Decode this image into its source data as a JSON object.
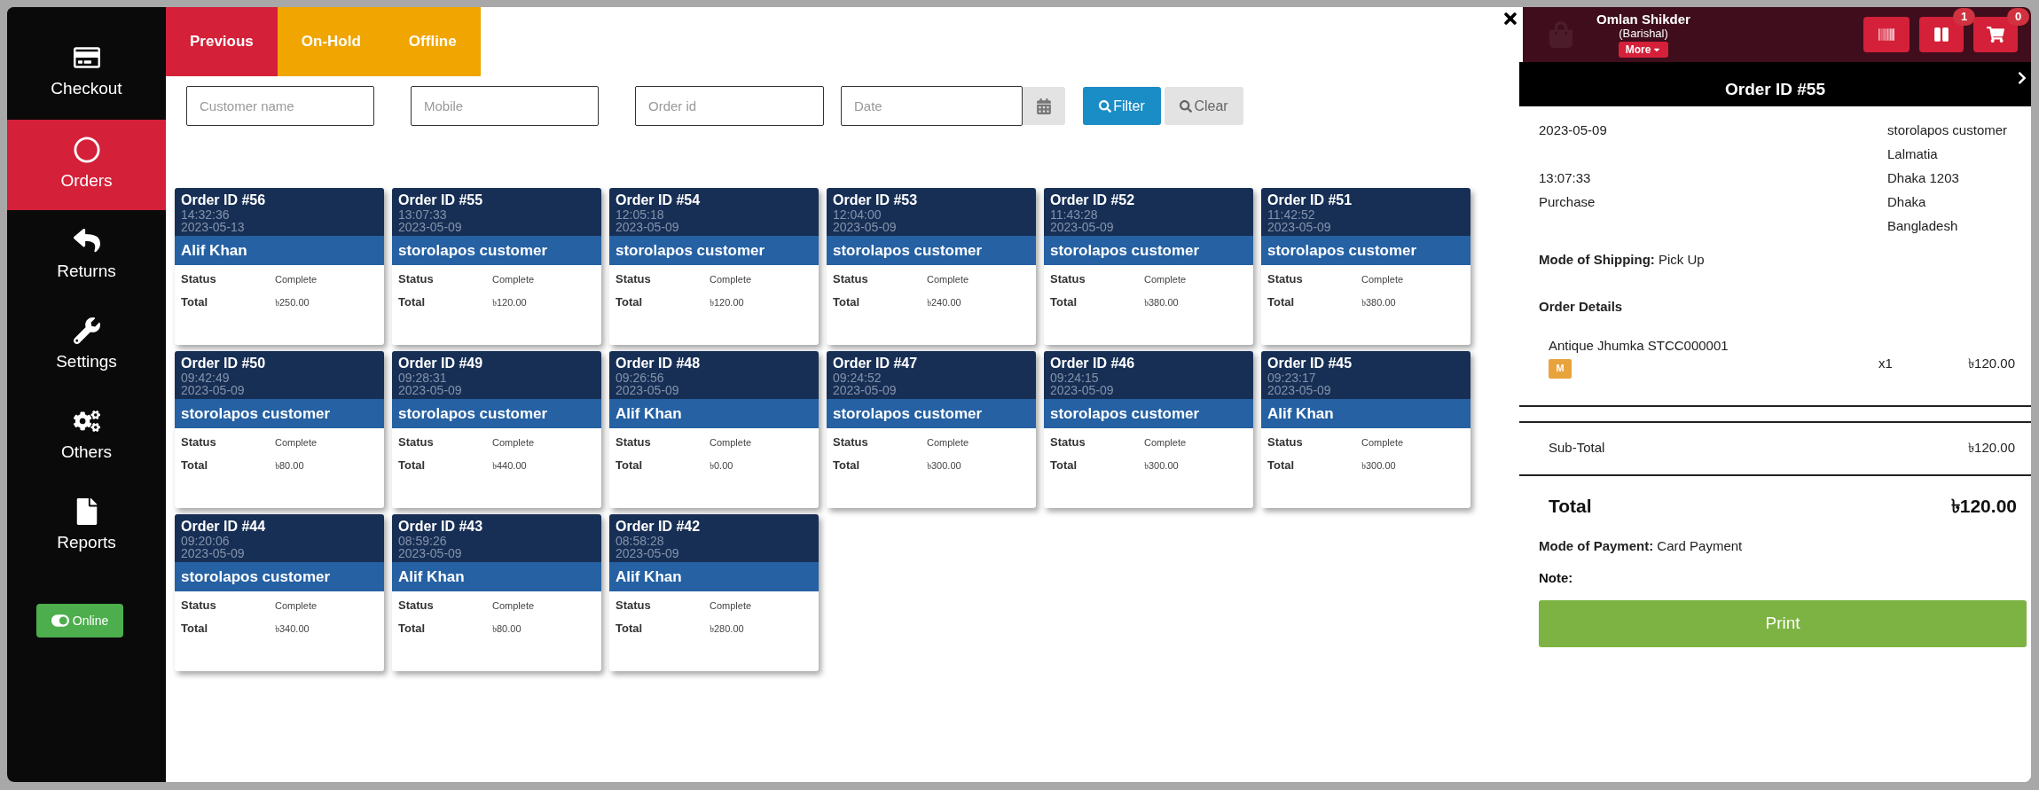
{
  "sidebar": {
    "items": [
      {
        "label": "Checkout",
        "selected": false
      },
      {
        "label": "Orders",
        "selected": true
      },
      {
        "label": "Returns",
        "selected": false
      },
      {
        "label": "Settings",
        "selected": false
      },
      {
        "label": "Others",
        "selected": false
      },
      {
        "label": "Reports",
        "selected": false
      }
    ],
    "connection_toggle": {
      "label": "Online",
      "on": true
    }
  },
  "tabs": [
    {
      "label": "Previous",
      "selected": true
    },
    {
      "label": "On-Hold",
      "selected": false
    },
    {
      "label": "Offline",
      "selected": false
    }
  ],
  "filters": {
    "customer_name": {
      "placeholder": "Customer name"
    },
    "mobile": {
      "placeholder": "Mobile"
    },
    "order_id": {
      "placeholder": "Order id"
    },
    "date": {
      "placeholder": "Date"
    },
    "filter_button": "Filter",
    "clear_button": "Clear"
  },
  "orders": [
    {
      "id": "Order ID #56",
      "time": "14:32:36",
      "date": "2023-05-13",
      "customer": "Alif Khan",
      "status_label": "Status",
      "status": "Complete",
      "total_label": "Total",
      "total": "৳250.00"
    },
    {
      "id": "Order ID #55",
      "time": "13:07:33",
      "date": "2023-05-09",
      "customer": "storolapos customer",
      "status_label": "Status",
      "status": "Complete",
      "total_label": "Total",
      "total": "৳120.00"
    },
    {
      "id": "Order ID #54",
      "time": "12:05:18",
      "date": "2023-05-09",
      "customer": "storolapos customer",
      "status_label": "Status",
      "status": "Complete",
      "total_label": "Total",
      "total": "৳120.00"
    },
    {
      "id": "Order ID #53",
      "time": "12:04:00",
      "date": "2023-05-09",
      "customer": "storolapos customer",
      "status_label": "Status",
      "status": "Complete",
      "total_label": "Total",
      "total": "৳240.00"
    },
    {
      "id": "Order ID #52",
      "time": "11:43:28",
      "date": "2023-05-09",
      "customer": "storolapos customer",
      "status_label": "Status",
      "status": "Complete",
      "total_label": "Total",
      "total": "৳380.00"
    },
    {
      "id": "Order ID #51",
      "time": "11:42:52",
      "date": "2023-05-09",
      "customer": "storolapos customer",
      "status_label": "Status",
      "status": "Complete",
      "total_label": "Total",
      "total": "৳380.00"
    },
    {
      "id": "Order ID #50",
      "time": "09:42:49",
      "date": "2023-05-09",
      "customer": "storolapos customer",
      "status_label": "Status",
      "status": "Complete",
      "total_label": "Total",
      "total": "৳80.00"
    },
    {
      "id": "Order ID #49",
      "time": "09:28:31",
      "date": "2023-05-09",
      "customer": "storolapos customer",
      "status_label": "Status",
      "status": "Complete",
      "total_label": "Total",
      "total": "৳440.00"
    },
    {
      "id": "Order ID #48",
      "time": "09:26:56",
      "date": "2023-05-09",
      "customer": "Alif Khan",
      "status_label": "Status",
      "status": "Complete",
      "total_label": "Total",
      "total": "৳0.00"
    },
    {
      "id": "Order ID #47",
      "time": "09:24:52",
      "date": "2023-05-09",
      "customer": "storolapos customer",
      "status_label": "Status",
      "status": "Complete",
      "total_label": "Total",
      "total": "৳300.00"
    },
    {
      "id": "Order ID #46",
      "time": "09:24:15",
      "date": "2023-05-09",
      "customer": "storolapos customer",
      "status_label": "Status",
      "status": "Complete",
      "total_label": "Total",
      "total": "৳300.00"
    },
    {
      "id": "Order ID #45",
      "time": "09:23:17",
      "date": "2023-05-09",
      "customer": "Alif Khan",
      "status_label": "Status",
      "status": "Complete",
      "total_label": "Total",
      "total": "৳300.00"
    },
    {
      "id": "Order ID #44",
      "time": "09:20:06",
      "date": "2023-05-09",
      "customer": "storolapos customer",
      "status_label": "Status",
      "status": "Complete",
      "total_label": "Total",
      "total": "৳340.00"
    },
    {
      "id": "Order ID #43",
      "time": "08:59:26",
      "date": "2023-05-09",
      "customer": "Alif Khan",
      "status_label": "Status",
      "status": "Complete",
      "total_label": "Total",
      "total": "৳80.00"
    },
    {
      "id": "Order ID #42",
      "time": "08:58:28",
      "date": "2023-05-09",
      "customer": "Alif Khan",
      "status_label": "Status",
      "status": "Complete",
      "total_label": "Total",
      "total": "৳280.00"
    }
  ],
  "detail_panel": {
    "header": {
      "user_name": "Omlan Shikder",
      "branch": "(Barishal)",
      "more_button": "More",
      "hold_badge": "1",
      "cart_badge": "0"
    },
    "title": "Order ID #55",
    "date": "2023-05-09",
    "time": "13:07:33",
    "type": "Purchase",
    "address": [
      "storolapos customer",
      "Lalmatia",
      "Dhaka 1203",
      "Dhaka",
      "Bangladesh"
    ],
    "shipping": "**Mode of Shipping:** Pick Up",
    "order_details_heading": "Order Details",
    "items": [
      {
        "name": "Antique Jhumka STCC000001",
        "tag": "M",
        "qty": "x1",
        "price": "৳120.00"
      }
    ],
    "subtotal_label": "Sub-Total",
    "subtotal": "৳120.00",
    "total_label": "Total",
    "total": "৳120.00",
    "payment": "**Mode of Payment:** Card Payment",
    "note_label": "Note:",
    "print_button": "Print"
  }
}
